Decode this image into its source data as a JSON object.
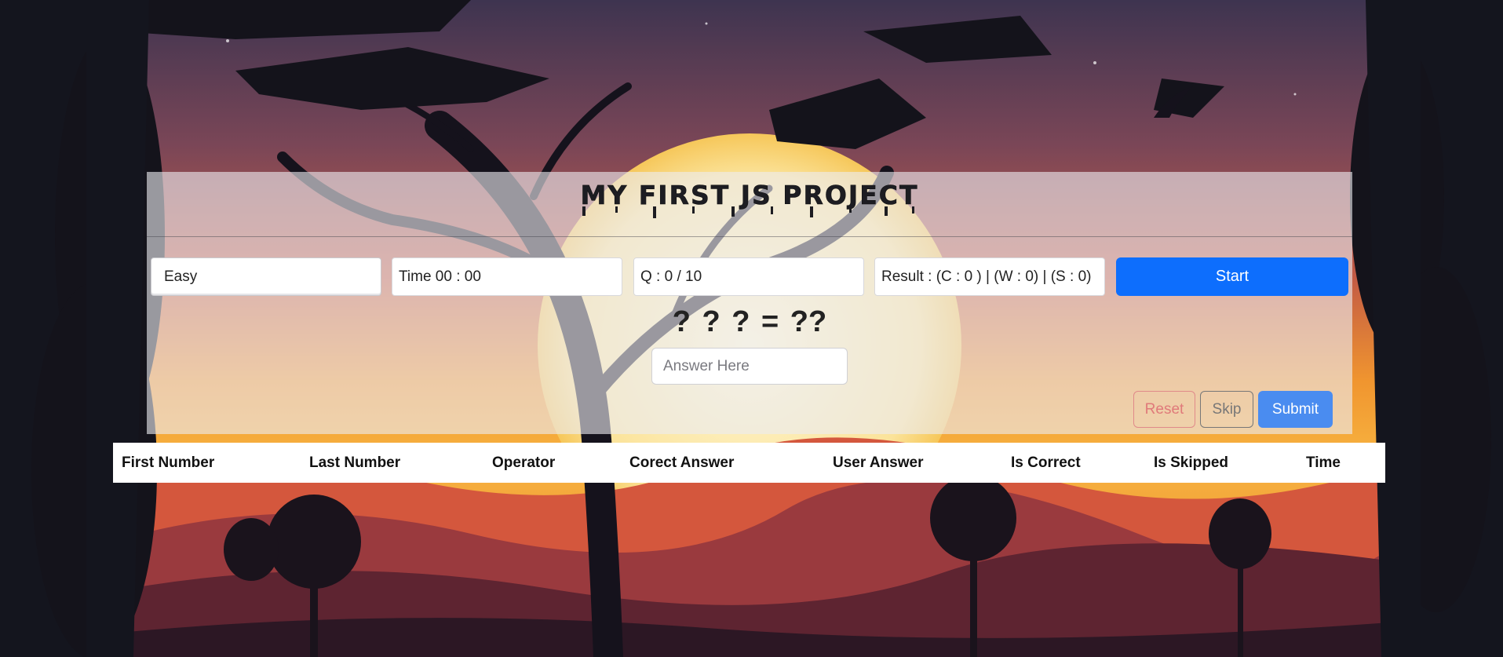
{
  "header": {
    "title": "MY FIRST JS PROJECT"
  },
  "controls": {
    "difficulty": "Easy",
    "timer": "Time 00 : 00",
    "question_count": "Q : 0 / 10",
    "result": "Result : (C : 0 ) | (W : 0) | (S : 0)",
    "start_label": "Start"
  },
  "question": {
    "expression": "? ? ? = ??"
  },
  "answer": {
    "placeholder": "Answer Here",
    "value": ""
  },
  "actions": {
    "reset_label": "Reset",
    "skip_label": "Skip",
    "submit_label": "Submit"
  },
  "table": {
    "headers": [
      "First Number",
      "Last Number",
      "Operator",
      "Corect Answer",
      "User Answer",
      "Is Correct",
      "Is Skipped",
      "Time"
    ]
  },
  "colors": {
    "primary": "#0d6efd",
    "danger": "#e07a7a",
    "secondary": "#777777"
  }
}
